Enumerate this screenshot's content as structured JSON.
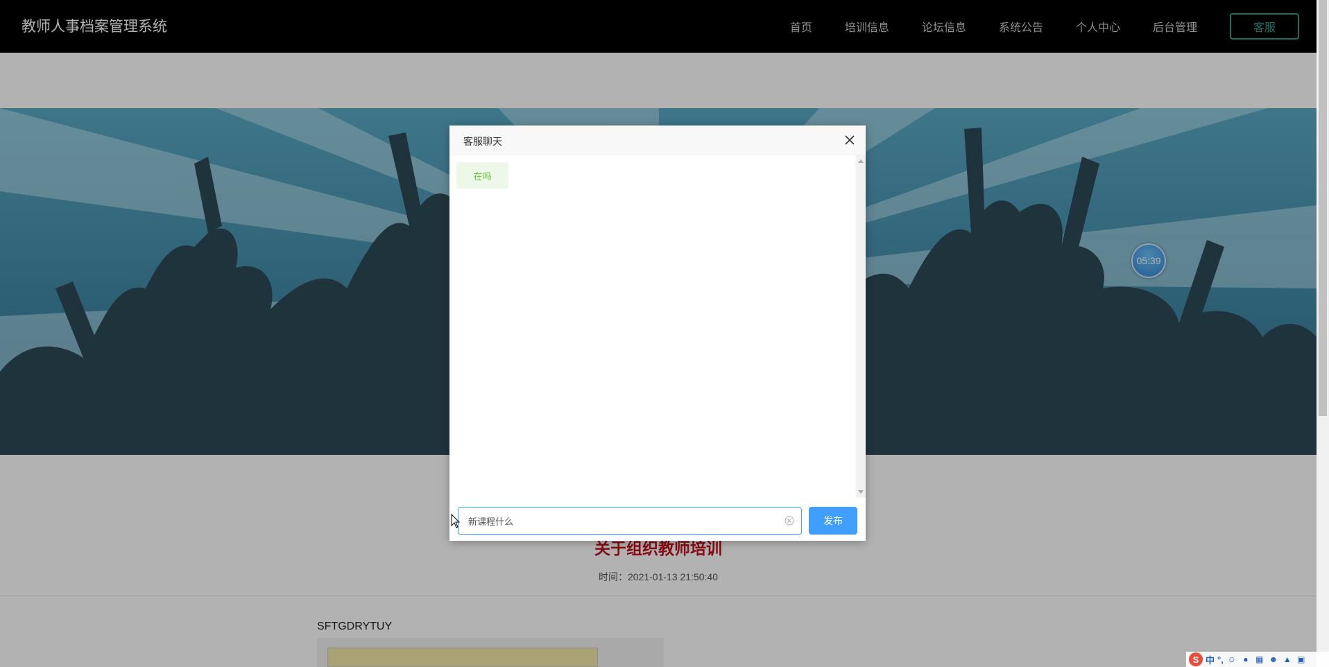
{
  "app": {
    "title": "教师人事档案管理系统"
  },
  "nav": {
    "items": [
      "首页",
      "培训信息",
      "论坛信息",
      "系统公告",
      "个人中心",
      "后台管理"
    ],
    "kefu_label": "客服"
  },
  "banner": {
    "timer_text": "05:39"
  },
  "article": {
    "title": "关于组织教师培训",
    "time": "时间：2021-01-13 21:50:40",
    "subtitle": "SFTGDRYTUY"
  },
  "dialog": {
    "title": "客服聊天",
    "messages": [
      {
        "text": "在吗",
        "side": "left"
      }
    ],
    "input_value": "新课程什么",
    "send_label": "发布"
  },
  "ime": {
    "logo": "S",
    "mode": "中",
    "punct": "°,"
  },
  "colors": {
    "nav_bg": "#000000",
    "accent": "#27a08f",
    "primary": "#409eff",
    "title_red": "#c0111b",
    "bubble_green": "#67c23a"
  }
}
